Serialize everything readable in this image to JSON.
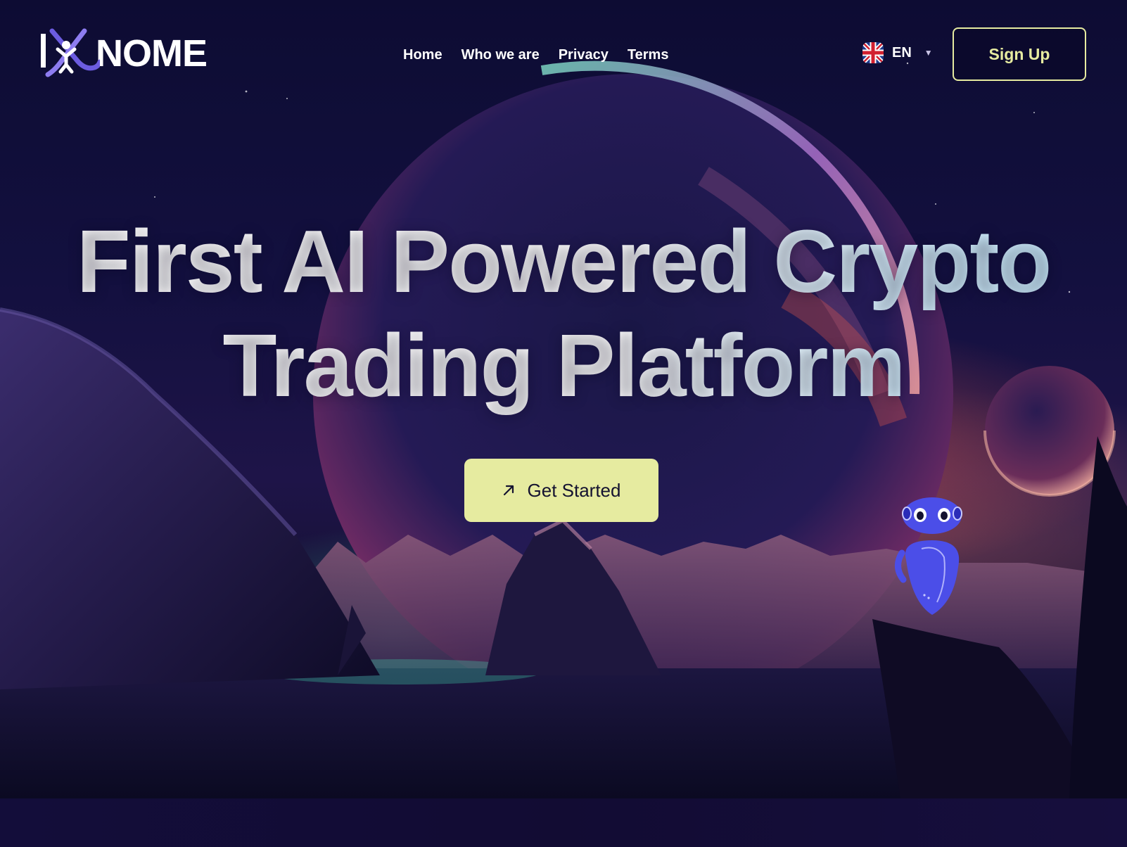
{
  "brand": {
    "name": "NOME",
    "logo_letter": "I",
    "colors": {
      "accent": "#e6eba0",
      "logo_purple": "#6c5ce0",
      "robot_blue": "#4b4ee8"
    }
  },
  "nav": {
    "links": [
      {
        "label": "Home"
      },
      {
        "label": "Who we are"
      },
      {
        "label": "Privacy"
      },
      {
        "label": "Terms"
      }
    ],
    "language": {
      "code": "EN",
      "flag_icon": "uk-flag-icon",
      "caret_icon": "caret-down-icon"
    },
    "signup_label": "Sign Up"
  },
  "hero": {
    "title_line1": "First AI Powered Crypto",
    "title_line2": "Trading Platform",
    "cta_label": "Get Started",
    "cta_icon": "arrow-up-right-icon",
    "illustration": "robot-mascot"
  }
}
